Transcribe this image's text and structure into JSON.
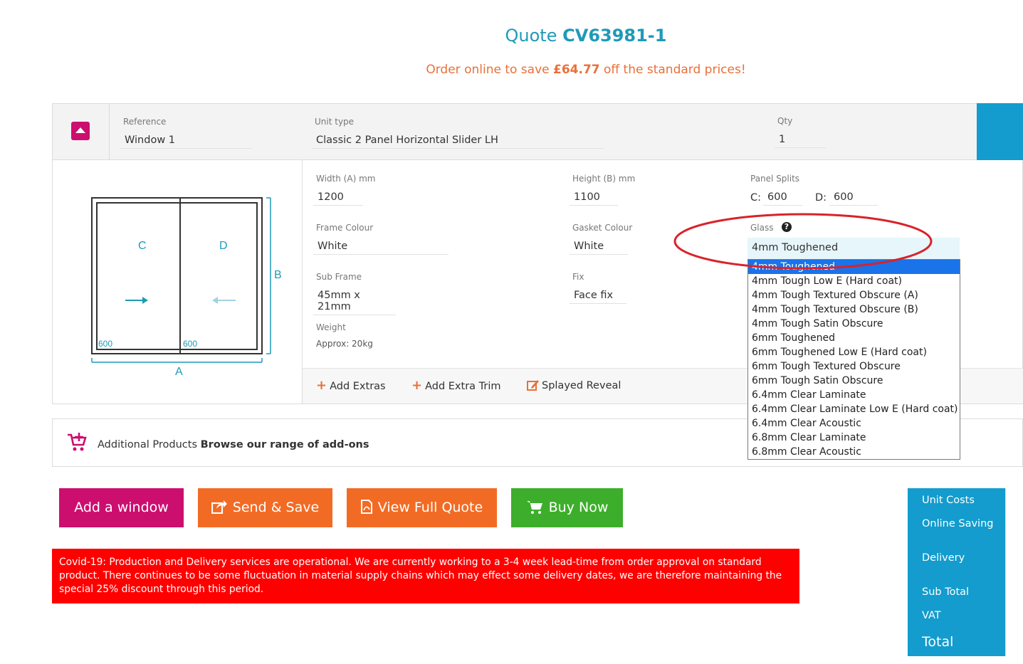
{
  "header": {
    "quote_prefix": "Quote",
    "quote_number": "CV63981-1",
    "save_prefix": "Order online to save",
    "save_amount": "£64.77",
    "save_suffix": "off the standard prices!"
  },
  "item": {
    "reference_label": "Reference",
    "reference_value": "Window 1",
    "unit_type_label": "Unit type",
    "unit_type_value": "Classic 2 Panel Horizontal Slider LH",
    "qty_label": "Qty",
    "qty_value": "1"
  },
  "drawing": {
    "panel_c": "C",
    "panel_d": "D",
    "dim_a": "A",
    "dim_b": "B",
    "split_c": "600",
    "split_d": "600"
  },
  "fields": {
    "width_label": "Width (A) mm",
    "width_value": "1200",
    "height_label": "Height (B) mm",
    "height_value": "1100",
    "splits_label": "Panel Splits",
    "split_c_label": "C:",
    "split_c_value": "600",
    "split_d_label": "D:",
    "split_d_value": "600",
    "frame_label": "Frame Colour",
    "frame_value": "White",
    "gasket_label": "Gasket Colour",
    "gasket_value": "White",
    "glass_label": "Glass",
    "glass_value": "4mm Toughened",
    "subframe_label": "Sub Frame",
    "subframe_value": "45mm x 21mm",
    "fix_label": "Fix",
    "fix_value": "Face fix",
    "weight_label": "Weight",
    "weight_value": "Approx: 20kg"
  },
  "glass_options": [
    "4mm Toughened",
    "4mm Tough Low E (Hard coat)",
    "4mm Tough Textured Obscure (A)",
    "4mm Tough Textured Obscure (B)",
    "4mm Tough Satin Obscure",
    "6mm Toughened",
    "6mm Toughened Low E (Hard coat)",
    "6mm Tough Textured Obscure",
    "6mm Tough Satin Obscure",
    "6.4mm Clear Laminate",
    "6.4mm Clear Laminate Low E (Hard coat)",
    "6.4mm Clear Acoustic",
    "6.8mm Clear Laminate",
    "6.8mm Clear Acoustic"
  ],
  "extras": {
    "add_extras": "Add Extras",
    "add_trim": "Add Extra Trim",
    "splayed": "Splayed Reveal"
  },
  "additional": {
    "label": "Additional Products",
    "link": "Browse our range of add-ons"
  },
  "buttons": {
    "add_window": "Add a window",
    "send_save": "Send & Save",
    "view_quote": "View Full Quote",
    "buy_now": "Buy Now"
  },
  "notice": "Covid-19: Production and Delivery services are operational. We are currently working to a 3-4 week lead-time from order approval on standard product. There continues to be some fluctuation in material supply chains which may effect some delivery dates, we are therefore maintaining the special 25% discount through this period.",
  "totals": {
    "unit_costs": "Unit Costs",
    "online_saving": "Online Saving",
    "delivery": "Delivery",
    "sub_total": "Sub Total",
    "vat": "VAT",
    "total": "Total"
  },
  "colors": {
    "accent_blue": "#139ccd",
    "magenta": "#cc0e6f",
    "orange": "#f26b24",
    "green": "#3dae2b",
    "alert_red": "#ff0000"
  }
}
